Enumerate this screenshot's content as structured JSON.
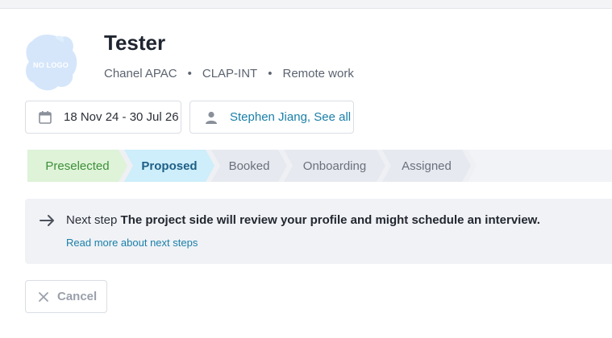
{
  "header": {
    "logo_text": "NO LOGO",
    "title": "Tester",
    "meta": [
      "Chanel APAC",
      "CLAP-INT",
      "Remote work"
    ],
    "meta_separator": "•"
  },
  "chips": {
    "date_range": "18 Nov 24 - 30 Jul 26",
    "person_name": "Stephen Jiang",
    "person_separator": ",",
    "see_all": "See all"
  },
  "pipeline": {
    "steps": [
      "Preselected",
      "Proposed",
      "Booked",
      "Onboarding",
      "Assigned"
    ],
    "current": "Proposed"
  },
  "next_step": {
    "label": "Next step",
    "message": "The project side will review your profile and might schedule an interview.",
    "read_more": "Read more about next steps"
  },
  "actions": {
    "cancel_label": "Cancel"
  },
  "colors": {
    "accent_link": "#1a7fa8",
    "preselected_bg": "#def3d8",
    "proposed_bg": "#cdeefa"
  }
}
